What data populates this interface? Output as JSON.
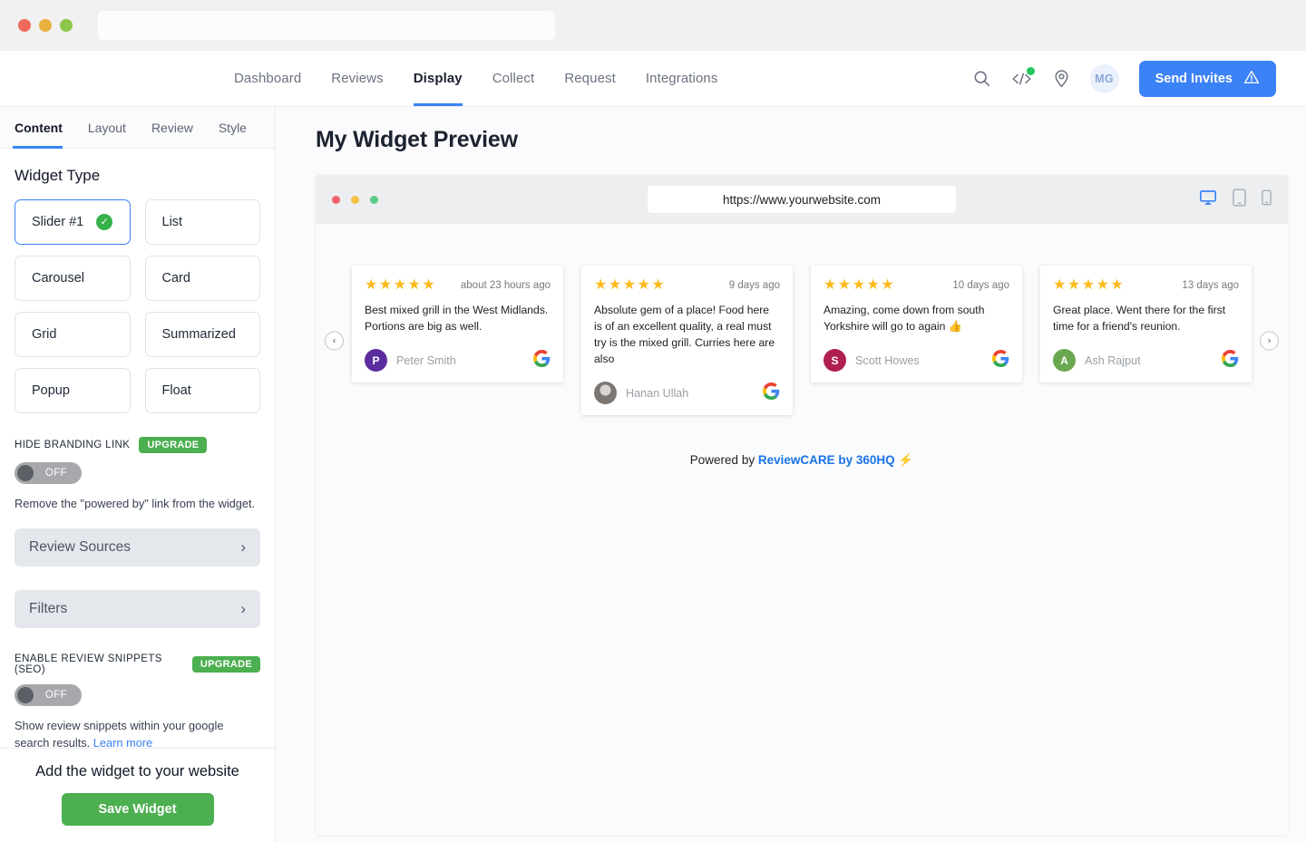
{
  "browser": {
    "url_value": "",
    "url_placeholder": "",
    "dots": [
      "red",
      "yellow",
      "green"
    ]
  },
  "header": {
    "nav": [
      {
        "label": "Dashboard",
        "active": false
      },
      {
        "label": "Reviews",
        "active": false
      },
      {
        "label": "Display",
        "active": true
      },
      {
        "label": "Collect",
        "active": false
      },
      {
        "label": "Request",
        "active": false
      },
      {
        "label": "Integrations",
        "active": false
      }
    ],
    "icons": [
      "search-icon",
      "code-icon",
      "location-pin-icon"
    ],
    "avatar_initials": "MG",
    "send_invites_label": "Send Invites",
    "accent_color": "#3b82f6"
  },
  "sidebar": {
    "tabs": [
      {
        "label": "Content",
        "active": true
      },
      {
        "label": "Layout",
        "active": false
      },
      {
        "label": "Review",
        "active": false
      },
      {
        "label": "Style",
        "active": false
      }
    ],
    "widget_type_title": "Widget Type",
    "widget_types": [
      {
        "label": "Slider #1",
        "selected": true
      },
      {
        "label": "List",
        "selected": false
      },
      {
        "label": "Carousel",
        "selected": false
      },
      {
        "label": "Card",
        "selected": false
      },
      {
        "label": "Grid",
        "selected": false
      },
      {
        "label": "Summarized",
        "selected": false
      },
      {
        "label": "Popup",
        "selected": false
      },
      {
        "label": "Float",
        "selected": false
      }
    ],
    "hide_branding": {
      "label": "HIDE BRANDING LINK",
      "badge": "UPGRADE",
      "toggle_state": "OFF",
      "description": "Remove the \"powered by\" link from the widget."
    },
    "review_sources_label": "Review Sources",
    "filters_label": "Filters",
    "seo_snippets": {
      "label": "ENABLE REVIEW SNIPPETS (SEO)",
      "badge": "UPGRADE",
      "toggle_state": "OFF",
      "description": "Show review snippets within your google search results.",
      "link_label": "Learn more"
    },
    "footer": {
      "title": "Add the widget to your website",
      "save_label": "Save Widget",
      "save_color": "#4caf50"
    }
  },
  "main": {
    "page_title": "My Widget Preview",
    "preview": {
      "url": "https://www.yourwebsite.com",
      "devices": [
        {
          "name": "desktop-icon",
          "active": true
        },
        {
          "name": "tablet-icon",
          "active": false
        },
        {
          "name": "mobile-icon",
          "active": false
        }
      ],
      "prev_label": "‹",
      "next_label": "›",
      "reviews": [
        {
          "stars": 5,
          "stars_glyphs": "★★★★★",
          "date": "about 23 hours ago",
          "text": "Best mixed grill in the West Midlands. Portions are big as well.",
          "author": "Peter Smith",
          "avatar_initial": "P",
          "avatar_color": "#5a2d9e",
          "source": "google"
        },
        {
          "stars": 5,
          "stars_glyphs": "★★★★★",
          "date": "9 days ago",
          "text": "Absolute gem of a place! Food here is of an excellent quality, a real must try is the mixed grill. Curries here are also",
          "author": "Hanan Ullah",
          "avatar_initial": "",
          "avatar_color": "#8d8d8d",
          "source": "google"
        },
        {
          "stars": 5,
          "stars_glyphs": "★★★★★",
          "date": "10 days ago",
          "text": "Amazing, come down from south Yorkshire will go to again 👍",
          "author": "Scott Howes",
          "avatar_initial": "S",
          "avatar_color": "#b01f52",
          "source": "google"
        },
        {
          "stars": 5,
          "stars_glyphs": "★★★★★",
          "date": "13 days ago",
          "text": "Great place. Went there for the first time for a friend's reunion.",
          "author": "Ash Rajput",
          "avatar_initial": "A",
          "avatar_color": "#6aa84f",
          "source": "google"
        }
      ],
      "powered_prefix": "Powered by ",
      "powered_brand": "ReviewCARE by 360HQ",
      "powered_suffix": " ⚡"
    }
  }
}
